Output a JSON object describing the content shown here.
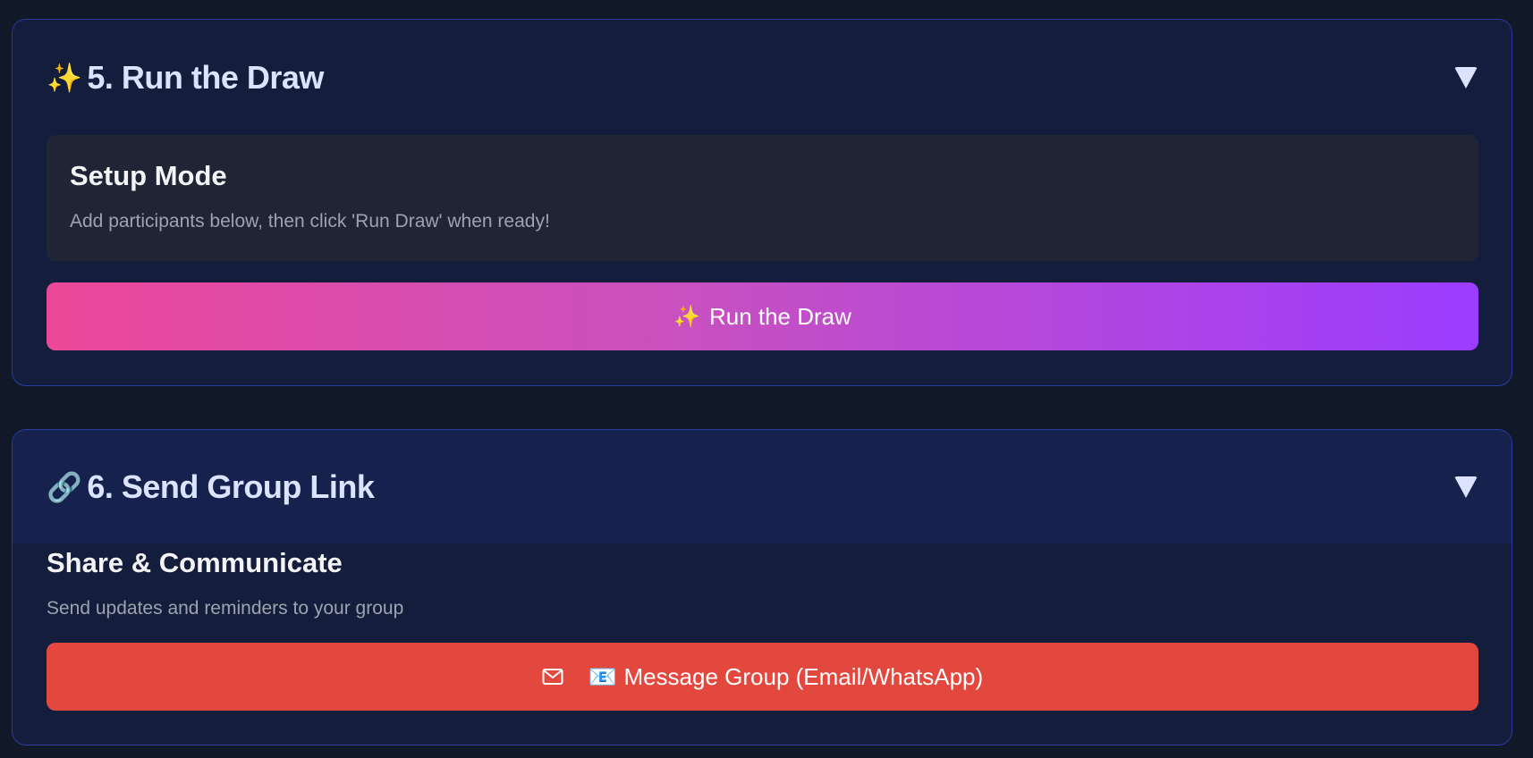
{
  "sections": [
    {
      "icon": "sparkles-icon",
      "icon_glyph": "✨",
      "title": "5. Run the Draw",
      "info": {
        "title": "Setup Mode",
        "description": "Add participants below, then click 'Run Draw' when ready!"
      },
      "button": {
        "icon_glyph": "✨",
        "label": "Run the Draw"
      }
    },
    {
      "icon": "link-icon",
      "icon_glyph": "🔗",
      "title": "6. Send Group Link",
      "info": {
        "title": "Share & Communicate",
        "description": "Send updates and reminders to your group"
      },
      "button": {
        "icon": "mail-icon",
        "label": "📧 Message Group (Email/WhatsApp)"
      }
    }
  ],
  "colors": {
    "background": "#111827",
    "card": "#141d3c",
    "card_border": "#2a3a9e",
    "draw_gradient_start": "#ec4899",
    "draw_gradient_end": "#9b3cff",
    "message_button": "#e2483e"
  }
}
